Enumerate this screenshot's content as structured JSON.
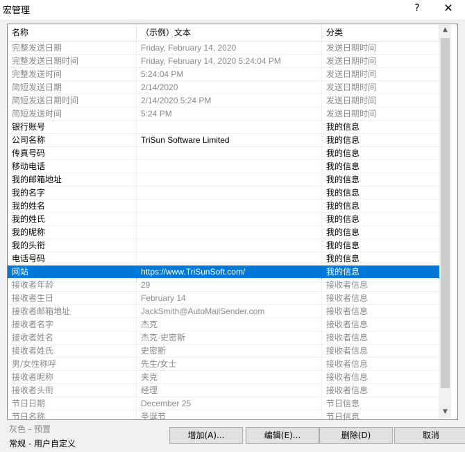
{
  "window": {
    "title": "宏管理",
    "help_glyph": "?",
    "close_glyph": "✕"
  },
  "columns": [
    "名称",
    "（示例）文本",
    "分类"
  ],
  "rows": [
    {
      "name": "完整发送日期",
      "example": "Friday, February 14, 2020",
      "category": "发送日期时间",
      "type": "preset"
    },
    {
      "name": "完整发送日期时间",
      "example": "Friday, February 14, 2020 5:24:04 PM",
      "category": "发送日期时间",
      "type": "preset"
    },
    {
      "name": "完整发送时间",
      "example": "5:24:04 PM",
      "category": "发送日期时间",
      "type": "preset"
    },
    {
      "name": "简短发送日期",
      "example": "2/14/2020",
      "category": "发送日期时间",
      "type": "preset"
    },
    {
      "name": "简短发送日期时间",
      "example": "2/14/2020 5:24 PM",
      "category": "发送日期时间",
      "type": "preset"
    },
    {
      "name": "简短发送时间",
      "example": "5:24 PM",
      "category": "发送日期时间",
      "type": "preset"
    },
    {
      "name": "银行账号",
      "example": "",
      "category": "我的信息",
      "type": "user"
    },
    {
      "name": "公司名称",
      "example": "TriSun Software Limited",
      "category": "我的信息",
      "type": "user"
    },
    {
      "name": "传真号码",
      "example": "",
      "category": "我的信息",
      "type": "user"
    },
    {
      "name": "移动电话",
      "example": "",
      "category": "我的信息",
      "type": "user"
    },
    {
      "name": "我的邮箱地址",
      "example": "",
      "category": "我的信息",
      "type": "user"
    },
    {
      "name": "我的名字",
      "example": "",
      "category": "我的信息",
      "type": "user"
    },
    {
      "name": "我的姓名",
      "example": "",
      "category": "我的信息",
      "type": "user"
    },
    {
      "name": "我的姓氏",
      "example": "",
      "category": "我的信息",
      "type": "user"
    },
    {
      "name": "我的昵称",
      "example": "",
      "category": "我的信息",
      "type": "user"
    },
    {
      "name": "我的头衔",
      "example": "",
      "category": "我的信息",
      "type": "user"
    },
    {
      "name": "电话号码",
      "example": "",
      "category": "我的信息",
      "type": "user"
    },
    {
      "name": "网站",
      "example": "https://www.TriSunSoft.com/",
      "category": "我的信息",
      "type": "user",
      "selected": true
    },
    {
      "name": "接收者年龄",
      "example": "29",
      "category": "接收者信息",
      "type": "preset"
    },
    {
      "name": "接收者生日",
      "example": "February 14",
      "category": "接收者信息",
      "type": "preset"
    },
    {
      "name": "接收者邮箱地址",
      "example": "JackSmith@AutoMailSender.com",
      "category": "接收者信息",
      "type": "preset"
    },
    {
      "name": "接收者名字",
      "example": "杰克",
      "category": "接收者信息",
      "type": "preset"
    },
    {
      "name": "接收者姓名",
      "example": "杰克·史密斯",
      "category": "接收者信息",
      "type": "preset"
    },
    {
      "name": "接收者姓氏",
      "example": "史密斯",
      "category": "接收者信息",
      "type": "preset"
    },
    {
      "name": "男/女性称呼",
      "example": "先生/女士",
      "category": "接收者信息",
      "type": "preset"
    },
    {
      "name": "接收者昵称",
      "example": "夹克",
      "category": "接收者信息",
      "type": "preset"
    },
    {
      "name": "接收者头衔",
      "example": "经理",
      "category": "接收者信息",
      "type": "preset"
    },
    {
      "name": "节日日期",
      "example": "December 25",
      "category": "节日信息",
      "type": "preset"
    },
    {
      "name": "节日名称",
      "example": "圣诞节",
      "category": "节日信息",
      "type": "preset"
    }
  ],
  "legend": {
    "preset": "灰色 - 预置",
    "user": "常规 - 用户自定义"
  },
  "buttons": {
    "add": "增加(A)...",
    "edit": "编辑(E)...",
    "delete": "删除(D)",
    "cancel": "取消"
  },
  "scrollbar": {
    "up_glyph": "▲",
    "down_glyph": "▼"
  }
}
